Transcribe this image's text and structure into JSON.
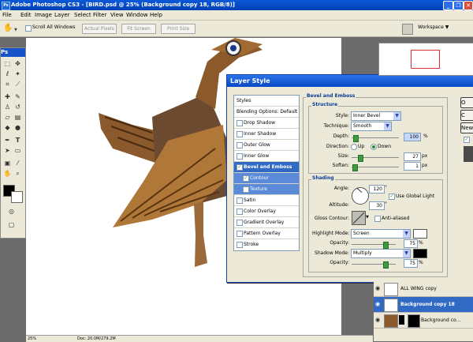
{
  "window": {
    "title": "Adobe Photoshop CS3 - [BIRD.psd @ 25% (Background copy 18, RGB/8)]",
    "app_icon": "Ps",
    "min_label": "_",
    "restore_label": "❐",
    "close_label": "✕"
  },
  "menu": [
    "File",
    "Edit",
    "Image",
    "Layer",
    "Select",
    "Filter",
    "View",
    "Window",
    "Help"
  ],
  "options_bar": {
    "scroll_all_windows": "Scroll All Windows",
    "actual_pixels": "Actual Pixels",
    "fit_screen": "Fit Screen",
    "print_size": "Print Size",
    "workspace": "Workspace ▼"
  },
  "tools_header": "Ps",
  "status": {
    "zoom": "25%",
    "doc": "Doc: 20.0M/279.2M"
  },
  "dialog": {
    "title": "Layer Style",
    "styles_list": [
      {
        "label": "Styles",
        "checkbox": false,
        "state": "header"
      },
      {
        "label": "Blending Options: Default",
        "checkbox": false,
        "state": "normal"
      },
      {
        "label": "Drop Shadow",
        "checkbox": true,
        "state": "normal"
      },
      {
        "label": "Inner Shadow",
        "checkbox": true,
        "state": "normal"
      },
      {
        "label": "Outer Glow",
        "checkbox": true,
        "state": "normal"
      },
      {
        "label": "Inner Glow",
        "checkbox": true,
        "state": "normal"
      },
      {
        "label": "Bevel and Emboss",
        "checkbox": true,
        "state": "selected"
      },
      {
        "label": "Contour",
        "checkbox": true,
        "state": "sub"
      },
      {
        "label": "Texture",
        "checkbox": true,
        "state": "sub"
      },
      {
        "label": "Satin",
        "checkbox": true,
        "state": "normal"
      },
      {
        "label": "Color Overlay",
        "checkbox": true,
        "state": "normal"
      },
      {
        "label": "Gradient Overlay",
        "checkbox": true,
        "state": "normal"
      },
      {
        "label": "Pattern Overlay",
        "checkbox": true,
        "state": "normal"
      },
      {
        "label": "Stroke",
        "checkbox": true,
        "state": "normal"
      }
    ],
    "section_title": "Bevel and Emboss",
    "structure": {
      "title": "Structure",
      "style_label": "Style:",
      "style_value": "Inner Bevel",
      "technique_label": "Technique:",
      "technique_value": "Smooth",
      "depth_label": "Depth:",
      "depth_value": "100",
      "depth_unit": "%",
      "direction_label": "Direction:",
      "direction_up": "Up",
      "direction_down": "Down",
      "size_label": "Size:",
      "size_value": "27",
      "size_unit": "px",
      "soften_label": "Soften:",
      "soften_value": "1",
      "soften_unit": "px"
    },
    "shading": {
      "title": "Shading",
      "angle_label": "Angle:",
      "angle_value": "120",
      "angle_unit": "°",
      "global_light": "Use Global Light",
      "altitude_label": "Altitude:",
      "altitude_value": "30",
      "altitude_unit": "°",
      "gloss_label": "Gloss Contour:",
      "anti_aliased": "Anti-aliased",
      "highlight_label": "Highlight Mode:",
      "highlight_value": "Screen",
      "highlight_opacity_label": "Opacity:",
      "highlight_opacity_value": "75",
      "highlight_opacity_unit": "%",
      "shadow_label": "Shadow Mode:",
      "shadow_value": "Multiply",
      "shadow_opacity_label": "Opacity:",
      "shadow_opacity_value": "75",
      "shadow_opacity_unit": "%"
    },
    "right_buttons": [
      "O",
      "C",
      "New"
    ]
  },
  "layers": [
    {
      "name": "ALL WING copy",
      "selected": false
    },
    {
      "name": "Background copy 18",
      "selected": true
    },
    {
      "name": "Background co...",
      "selected": false
    }
  ],
  "colors": {
    "titlebar": "#0a58d8",
    "selection": "#316ac5",
    "dialog_bg": "#ece9d8"
  }
}
